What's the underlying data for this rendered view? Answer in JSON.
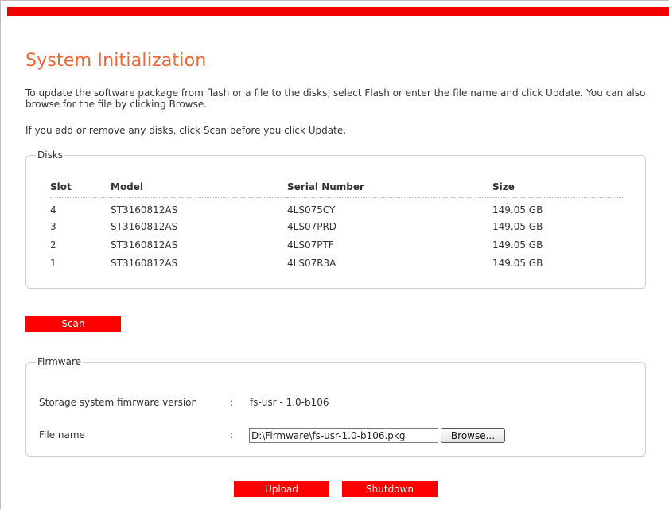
{
  "header": {
    "title": "System Initialization",
    "accent_color": "#f20000",
    "title_color": "#ee6633"
  },
  "instructions": {
    "line1": "To update the software package from flash or a file to the disks, select Flash or enter the file name and click Update. You can also browse for the file by clicking Browse.",
    "line2": "If you add or remove any disks, click Scan before you click Update."
  },
  "disks": {
    "legend": "Disks",
    "columns": [
      "Slot",
      "Model",
      "Serial Number",
      "Size"
    ],
    "rows": [
      [
        "4",
        "ST3160812AS",
        "4LS075CY",
        "149.05 GB"
      ],
      [
        "3",
        "ST3160812AS",
        "4LS07PRD",
        "149.05 GB"
      ],
      [
        "2",
        "ST3160812AS",
        "4LS07PTF",
        "149.05 GB"
      ],
      [
        "1",
        "ST3160812AS",
        "4LS07R3A",
        "149.05 GB"
      ]
    ]
  },
  "scan_button": "Scan",
  "firmware": {
    "legend": "Firmware",
    "version_label": "Storage system fimrware version",
    "version_colon": ":",
    "version_value": "fs-usr - 1.0-b106",
    "file_label": "File name",
    "file_colon": ":",
    "file_value": "D:\\Firmware\\fs-usr-1.0-b106.pkg",
    "browse_label": "Browse..."
  },
  "footer": {
    "upload_label": "Upload",
    "shutdown_label": "Shutdown"
  }
}
